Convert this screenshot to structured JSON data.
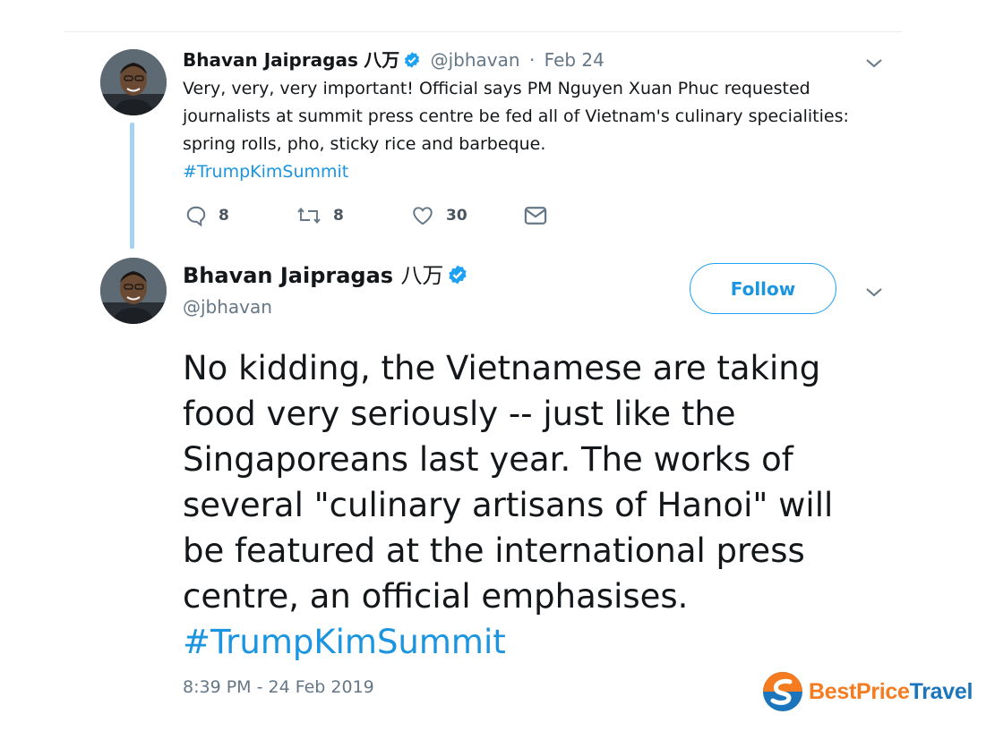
{
  "tweet1": {
    "author_name": "Bhavan Jaipragas",
    "author_cjk": "八万",
    "handle": "@jbhavan",
    "date": "Feb 24",
    "text_lines": [
      "Very, very, very important! Official says PM Nguyen Xuan Phuc requested",
      "journalists at summit press centre be fed all of Vietnam's culinary specialities:",
      "spring rolls, pho, sticky rice and barbeque."
    ],
    "hashtag": "#TrumpKimSummit",
    "replies": "8",
    "retweets": "8",
    "likes": "30"
  },
  "tweet2": {
    "author_name": "Bhavan Jaipragas",
    "author_cjk": "八万",
    "handle": "@jbhavan",
    "follow_label": "Follow",
    "text_lines": [
      "No kidding, the Vietnamese are taking",
      "food very seriously -- just like the",
      "Singaporeans last year. The works of",
      "several \"culinary artisans of Hanoi\" will",
      "be featured at the international press",
      "centre, an official emphasises."
    ],
    "hashtag": "#TrumpKimSummit",
    "timestamp": "8:39 PM - 24 Feb 2019"
  },
  "watermark": {
    "part1": "BestPrice",
    "part2": "Travel"
  },
  "icons": {
    "verified": "verified-badge-icon",
    "chevron": "chevron-down-icon",
    "reply": "reply-icon",
    "retweet": "retweet-icon",
    "like": "heart-icon",
    "dm": "envelope-icon"
  },
  "colors": {
    "link": "#1b95e0",
    "accent": "#1da1f2",
    "muted": "#657786",
    "thread_line": "#a6d2f2",
    "logo_orange": "#f47b20",
    "logo_blue": "#1b75bc"
  }
}
